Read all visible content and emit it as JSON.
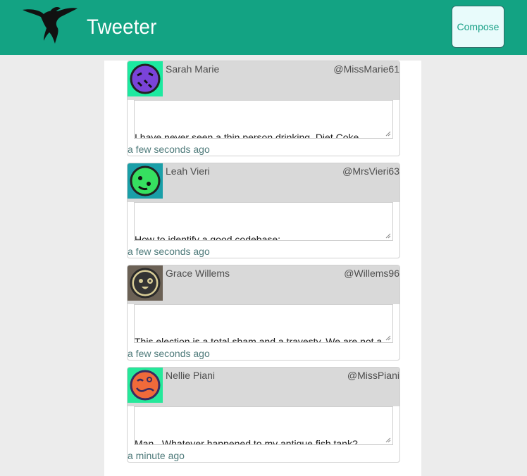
{
  "header": {
    "app_title": "Tweeter",
    "compose_label": "Compose",
    "bg_color": "#13a383",
    "logo_icon": "hummingbird-icon"
  },
  "tweets": [
    {
      "name": "Sarah Marie",
      "handle": "@MissMarie61",
      "text": "I have never seen a thin person drinking  Diet Coke.",
      "time": "a few seconds ago",
      "avatar_icon": "purple-face-avatar-icon",
      "avatar_bg": "#1de9a0",
      "avatar_face": "#7a43d9"
    },
    {
      "name": "Leah Vieri",
      "handle": "@MrsVieri63",
      "text": "How to identify a good codebase:\n\n• You'll know when you see it",
      "time": "a few seconds ago",
      "avatar_icon": "green-face-avatar-icon",
      "avatar_bg": "#1a9fa8",
      "avatar_face": "#36e060"
    },
    {
      "name": "Grace Willems",
      "handle": "@Willems96",
      "text": "This election is a total sham and a travesty. We are not a democracy!",
      "time": "a few seconds ago",
      "avatar_icon": "tan-face-avatar-icon",
      "avatar_bg": "#6b6155",
      "avatar_face": "#d8cc96"
    },
    {
      "name": "Nellie Piani",
      "handle": "@MissPiani",
      "text": "Man.. Whatever happened to my antique fish tank?",
      "time": "a minute ago",
      "avatar_icon": "orange-face-avatar-icon",
      "avatar_bg": "#25e89a",
      "avatar_face": "#f06a3a"
    }
  ]
}
